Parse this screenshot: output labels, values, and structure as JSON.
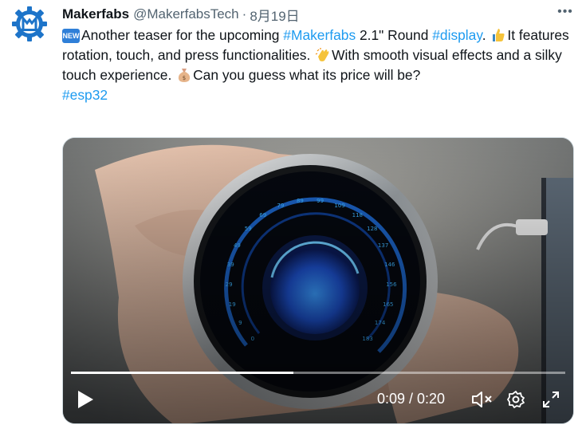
{
  "tweet": {
    "author_name": "Makerfabs",
    "handle": "@MakerfabsTech",
    "separator": "·",
    "date": "8月19日",
    "more_label": "•••",
    "new_badge": "NEW",
    "text_part1": "Another teaser for the upcoming ",
    "hashtag_makerfabs": "#Makerfabs",
    "text_part2": " 2.1\" Round ",
    "hashtag_display": "#display",
    "text_part3": ". ",
    "text_part4": "It features rotation, touch, and press functionalities. ",
    "text_part5": "With smooth visual effects and a silky touch experience. ",
    "text_part6": "Can you guess what its price will be?",
    "hashtag_esp32": "#esp32"
  },
  "video": {
    "current_time": "0:09",
    "duration": "0:20",
    "time_display": "0:09 / 0:20",
    "progress": 0.45,
    "gauge_ticks": [
      "0",
      "9",
      "19",
      "29",
      "39",
      "49",
      "59",
      "69",
      "79",
      "89",
      "99",
      "109",
      "118",
      "128",
      "137",
      "146",
      "156",
      "165",
      "174",
      "183"
    ]
  },
  "colors": {
    "link": "#1d9bf0",
    "secondary_text": "#536471",
    "brand": "#1d74c9"
  }
}
